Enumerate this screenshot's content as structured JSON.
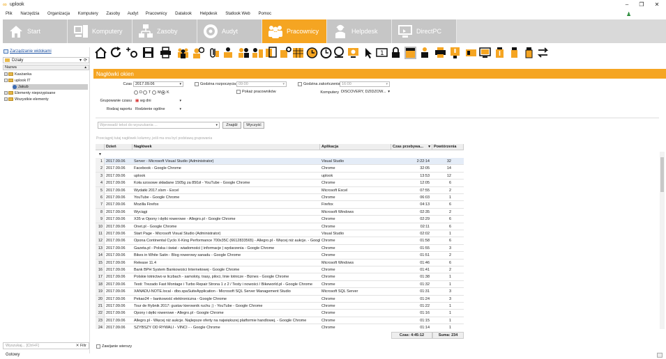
{
  "window": {
    "title": "uplook",
    "minimize": "–",
    "maximize": "❐",
    "close": "✕"
  },
  "menu": [
    "Plik",
    "Narzędzia",
    "Organizacja",
    "Komputery",
    "Zasoby",
    "Audyt",
    "Pracownicy",
    "Datalook",
    "Helpdesk",
    "Statlook Web",
    "Pomoc"
  ],
  "tabs": [
    {
      "label": "Start",
      "icon": "house-icon",
      "width": 93
    },
    {
      "label": "Komputery",
      "icon": "computer-icon",
      "width": 93
    },
    {
      "label": "Zasoby",
      "icon": "network-icon",
      "width": 93
    },
    {
      "label": "Audyt",
      "icon": "audit-disc-icon",
      "width": 93
    },
    {
      "label": "Pracownicy",
      "icon": "people-icon",
      "width": 93,
      "active": true
    },
    {
      "label": "Helpdesk",
      "icon": "helpdesk-icon",
      "width": 93
    },
    {
      "label": "DirectPC",
      "icon": "remote-screen-icon",
      "width": 93
    }
  ],
  "left": {
    "link": "Zarządzanie widokami",
    "combo": "Działy",
    "col_header": "Nazwa",
    "tree": [
      {
        "label": "Kasżanka",
        "level": 0,
        "expand": "+"
      },
      {
        "label": "uplook IT",
        "level": 0,
        "expand": "−"
      },
      {
        "label": "Jakub",
        "level": 1,
        "user": true,
        "selected": true
      },
      {
        "label": "Elementy nieprzypisane",
        "level": 0,
        "expand": "+"
      },
      {
        "label": "Wszystkie elementy",
        "level": 0,
        "expand": "+"
      }
    ],
    "search_placeholder": "Wyszukaj... [Ctrl+F]",
    "filter_label": "✕ Filtr"
  },
  "content_title": "Nagłówki okien",
  "form": {
    "czas_label": "Czas",
    "czas_value": "2017.09.06",
    "godz_rozp_label": "Godzina rozpoczęcia",
    "godz_rozp_value": "09:00",
    "godz_zak_label": "Godzina zakończenia",
    "godz_zak_value": "16:00",
    "pokaz_label": "Pokaż pracowników",
    "komputery_label": "Komputery",
    "komputery_value": "DISCOVERY, DZIDZOW...",
    "radios": [
      "D",
      "T",
      "M",
      "K"
    ],
    "radio_selected": 3,
    "grupowanie_label": "Grupowanie czasu",
    "grupowanie_value": "wg dni",
    "rodzaj_label": "Rodzaj raportu",
    "rodzaj_value": "Rodzienie ogólne",
    "search_placeholder": "Wprowadź tekst do wyszukania ...",
    "find_button": "Znajdź",
    "clear_button": "Wyczyść",
    "group_hint": "Przeciągnij tutaj nagłówek kolumny, jeśli ma ona być podstawą grupowania",
    "wrap_label": "Zawijanie wierszy"
  },
  "grid": {
    "columns": [
      "Dzień",
      "Nagłówek",
      "Aplikacja",
      "Czas przebywa...",
      "Powtórzenia"
    ],
    "rows": [
      [
        "2017.09.06",
        "Server - Microsoft Visual Studio (Administrator)",
        "Visual Studio",
        "2:22:14",
        "32"
      ],
      [
        "2017.09.06",
        "Facebook - Google Chrome",
        "Chrome",
        "32:05",
        "14"
      ],
      [
        "2017.09.06",
        "uplook",
        "uplook",
        "13:53",
        "12"
      ],
      [
        "2017.09.06",
        "Koła szosowe składane 1505g za 850zł - YouTube - Google Chrome",
        "Chrome",
        "12:05",
        "6"
      ],
      [
        "2017.09.06",
        "Wydatki 2017.xlsm - Excel",
        "Microsoft Excel",
        "07:55",
        "2"
      ],
      [
        "2017.09.06",
        "YouTube - Google Chrome",
        "Chrome",
        "06:03",
        "1"
      ],
      [
        "2017.09.06",
        "Mozilla Firefox",
        "Firefox",
        "04:13",
        "6"
      ],
      [
        "2017.09.06",
        "Wyciągi",
        "Microsoft Windows",
        "02:35",
        "2"
      ],
      [
        "2017.09.06",
        "X35 w Opony i dętki rowerowe - Allegro.pl - Google Chrome",
        "Chrome",
        "02:29",
        "6"
      ],
      [
        "2017.09.06",
        "Onet.pl - Google Chrome",
        "Chrome",
        "02:11",
        "6"
      ],
      [
        "2017.09.06",
        "Start Page - Microsoft Visual Studio (Administrator)",
        "Visual Studio",
        "02:02",
        "1"
      ],
      [
        "2017.09.06",
        "Opona Continental Cyclo X-King Performance 700x35C (6612833565) - Allegro.pl - Więcej niż aukcje. - Google",
        "Chrome",
        "01:58",
        "6"
      ],
      [
        "2017.09.06",
        "Gazeta.pl - Polska i świat - wiadomości | informacje | wydarzenia - Google Chrome",
        "Chrome",
        "01:55",
        "3"
      ],
      [
        "2017.09.06",
        "Bikes in White Satin - Blog rowerowy sanadu - Google Chrome",
        "Chrome",
        "01:51",
        "2"
      ],
      [
        "2017.09.06",
        "Release 11.4",
        "Microsoft Windows",
        "01:46",
        "6"
      ],
      [
        "2017.09.06",
        "Bank BPH System Bankowości Internetowej - Google Chrome",
        "Chrome",
        "01:41",
        "2"
      ],
      [
        "2017.09.06",
        "Polskie lotnictwo w liczbach - samoloty, trasy, piloci, linie lotnicze - Biznes - Google Chrome",
        "Chrome",
        "01:38",
        "1"
      ],
      [
        "2017.09.06",
        "Testi: Trezado Fast Montage i Turbo Repair Strona 1 z 2 / Testy i nowości / Bikeworld.pl - Google Chrome",
        "Chrome",
        "01:32",
        "1"
      ],
      [
        "2017.09.06",
        "XANADU-NOTE.local - dbo.spaSuiteApplication - Microsoft SQL Server Management Studio",
        "Microsoft SQL Server",
        "01:31",
        "3"
      ],
      [
        "2017.09.06",
        "Pekao24 – bankowość elektroniczna - Google Chrome",
        "Chrome",
        "01:24",
        "3"
      ],
      [
        "2017.09.06",
        "Tour de Rybnik 2017: gustav kierownik ruchu ;) - YouTube - Google Chrome",
        "Chrome",
        "01:22",
        "1"
      ],
      [
        "2017.09.06",
        "Opony i dętki rowerowe - Allegro.pl - Google Chrome",
        "Chrome",
        "01:16",
        "1"
      ],
      [
        "2017.09.06",
        "Allegro.pl - Więcej niż aukcje. Najlepsze oferty na największej platformie handlowej. - Google Chrome",
        "Chrome",
        "01:15",
        "1"
      ],
      [
        "2017.09.06",
        "SZYBSZY OD RYWALI - VINCI - - Google Chrome",
        "Chrome",
        "01:14",
        "1"
      ]
    ],
    "footer_time": "Czas: 4:45:12",
    "footer_sum": "Suma: 234"
  },
  "status": "Gotowy",
  "colors": {
    "accent": "#f5a522",
    "tab_bg": "#c6c6c6",
    "icon": "#111111"
  }
}
